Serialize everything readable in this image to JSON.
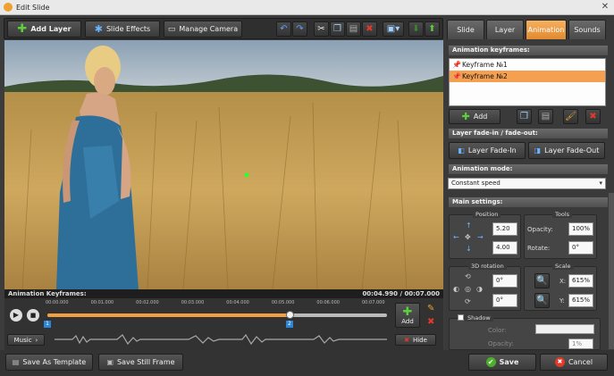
{
  "window": {
    "title": "Edit Slide",
    "close": "✕"
  },
  "toolbar": {
    "add_layer": "Add Layer",
    "slide_effects": "Slide Effects",
    "manage_camera": "Manage Camera"
  },
  "tabs": [
    "Slide",
    "Layer",
    "Animation",
    "Sounds"
  ],
  "active_tab": "Animation",
  "animation_keyframes": {
    "header": "Animation keyframes:",
    "items": [
      "Keyframe №1",
      "Keyframe №2"
    ],
    "selected": "Keyframe №2",
    "add_label": "Add"
  },
  "fade": {
    "header": "Layer fade-in / fade-out:",
    "fade_in": "Layer Fade-In",
    "fade_out": "Layer Fade-Out"
  },
  "animation_mode": {
    "header": "Animation mode:",
    "value": "Constant speed"
  },
  "main_settings": {
    "header": "Main settings:",
    "position_label": "Position",
    "position_x": "5.20",
    "position_y": "4.00",
    "tools_label": "Tools",
    "opacity_label": "Opacity:",
    "opacity_value": "100%",
    "rotate_label": "Rotate:",
    "rotate_value": "0°",
    "rotation_3d_label": "3D rotation",
    "rot_x": "0°",
    "rot_y": "0°",
    "scale_label": "Scale",
    "scale_x_label": "X:",
    "scale_x": "615%",
    "scale_y_label": "Y:",
    "scale_y": "615%",
    "shadow_label": "Shadow",
    "color_label": "Color:",
    "shadow_opacity_label": "Opacity:",
    "shadow_opacity_value": "1%"
  },
  "timeline": {
    "header": "Animation Keyframes:",
    "current_time": "00:04.990",
    "total_time": "00:07.000",
    "ticks": [
      "00:00.000",
      "00:01.000",
      "00:02.000",
      "00:03.000",
      "00:04.000",
      "00:05.000",
      "00:06.000",
      "00:07.000"
    ],
    "markers": [
      "1",
      "2"
    ],
    "progress": 0.713,
    "music_label": "Music",
    "add_label": "Add",
    "hide_label": "Hide"
  },
  "bottom": {
    "save_template": "Save As Template",
    "save_frame": "Save Still Frame",
    "save": "Save",
    "cancel": "Cancel"
  },
  "colors": {
    "accent": "#f0a040",
    "green": "#4caf2a",
    "red": "#e03a2a"
  }
}
